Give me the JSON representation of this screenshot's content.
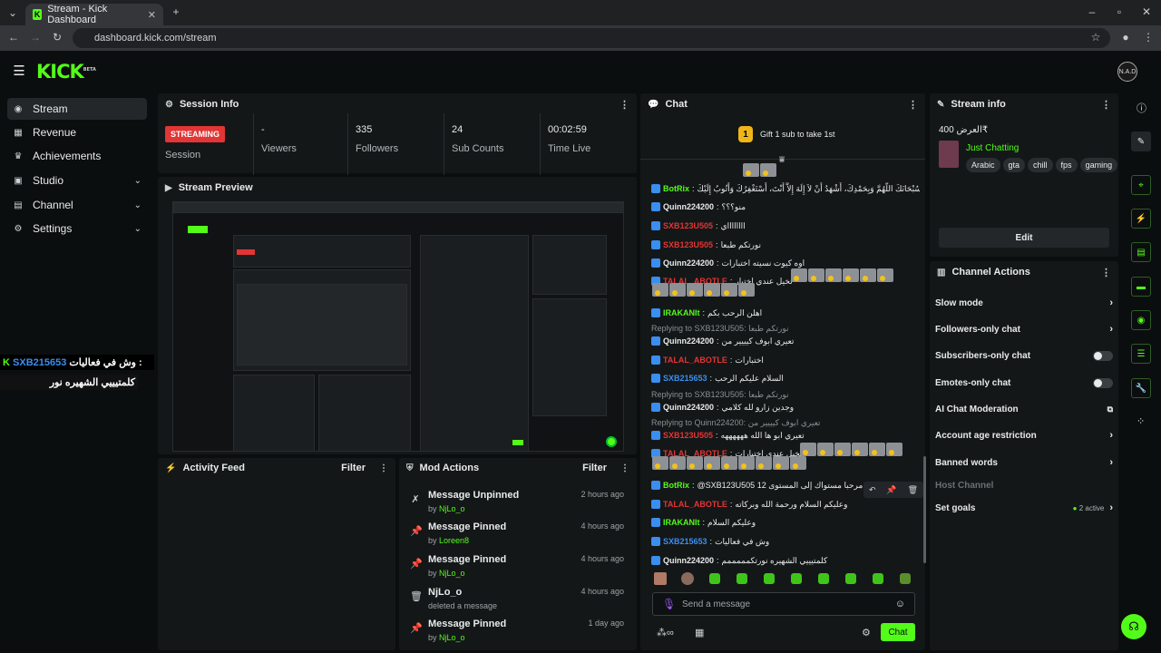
{
  "browser": {
    "tab_title": "Stream - Kick Dashboard",
    "url": "dashboard.kick.com/stream"
  },
  "header": {
    "logo": "KICK",
    "logo_badge": "BETA",
    "avatar_text": "N.A.D"
  },
  "sidebar": {
    "items": [
      {
        "label": "Stream",
        "icon": "broadcast-icon"
      },
      {
        "label": "Revenue",
        "icon": "revenue-icon"
      },
      {
        "label": "Achievements",
        "icon": "trophy-icon"
      },
      {
        "label": "Studio",
        "icon": "studio-icon"
      },
      {
        "label": "Channel",
        "icon": "channel-icon"
      },
      {
        "label": "Settings",
        "icon": "gear-icon"
      }
    ]
  },
  "session": {
    "title": "Session Info",
    "status": "STREAMING",
    "status_label": "Session",
    "stats": [
      {
        "value": "-",
        "label": "Viewers"
      },
      {
        "value": "335",
        "label": "Followers"
      },
      {
        "value": "24",
        "label": "Sub Counts"
      },
      {
        "value": "00:02:59",
        "label": "Time Live"
      }
    ]
  },
  "preview": {
    "title": "Stream Preview"
  },
  "overlay_chat": [
    {
      "user": "SXB215653",
      "text": "وش في فعاليات :"
    },
    {
      "user": "",
      "text": "كلمتيييي الشهيره نور"
    }
  ],
  "activity_feed": {
    "title": "Activity Feed",
    "filter": "Filter"
  },
  "mod_actions": {
    "title": "Mod Actions",
    "filter": "Filter",
    "items": [
      {
        "title": "Message Unpinned",
        "prefix": "by",
        "user": "NjLo_o",
        "time": "2 hours ago",
        "icon": "unpin-icon"
      },
      {
        "title": "Message Pinned",
        "prefix": "by",
        "user": "Loreen8",
        "time": "4 hours ago",
        "icon": "pin-icon"
      },
      {
        "title": "Message Pinned",
        "prefix": "by",
        "user": "NjLo_o",
        "time": "4 hours ago",
        "icon": "pin-icon"
      },
      {
        "title": "NjLo_o",
        "prefix": "",
        "user": "deleted a message",
        "time": "4 hours ago",
        "icon": "trash-icon"
      },
      {
        "title": "Message Pinned",
        "prefix": "by",
        "user": "NjLo_o",
        "time": "1 day ago",
        "icon": "pin-icon"
      }
    ]
  },
  "chat": {
    "title": "Chat",
    "gift_count": "1",
    "gift_text": "Gift 1 sub to take 1st",
    "lines": [
      {
        "kind": "msg",
        "user": "BotRix",
        "color": "ug",
        "text": "سُبْحَانَكَ اللَّهُمَّ وَبِحَمْدِكَ، أَشْهَدُ أَنْ لاَ إِلَهَ إِلاَّ أَنْتَ، أَسْتَغْفِرُكَ وَأَتُوبُ إِلَيْكَ"
      },
      {
        "kind": "msg",
        "user": "Quinn224200",
        "color": "uq",
        "text": "منو؟؟؟"
      },
      {
        "kind": "msg",
        "user": "SXB123U505",
        "color": "ur",
        "text": "ااااااااي"
      },
      {
        "kind": "msg",
        "user": "SXB123U505",
        "color": "ur",
        "text": "نورتكم طبعا"
      },
      {
        "kind": "msg",
        "user": "Quinn224200",
        "color": "uq",
        "text": "اوه كيوت نسيته اختبارات"
      },
      {
        "kind": "msg",
        "user": "TALAL_ABOTLE",
        "color": "ur",
        "text": "تخيل عندي اختبار"
      },
      {
        "kind": "msg",
        "user": "IRAKANIt",
        "color": "ug",
        "text": "اهلن الرحب بكم"
      },
      {
        "kind": "reply",
        "text": "Replying to SXB123U505: نورتكم طبعا"
      },
      {
        "kind": "msg",
        "user": "Quinn224200",
        "color": "uq",
        "text": "تعيري ابوف كيييير من"
      },
      {
        "kind": "msg",
        "user": "TALAL_ABOTLE",
        "color": "ur",
        "text": "اختبارات"
      },
      {
        "kind": "msg",
        "user": "SXB215653",
        "color": "ub",
        "text": "السلام عليكم الرحب"
      },
      {
        "kind": "reply",
        "text": "Replying to SXB123U505: نورتكم طبعا"
      },
      {
        "kind": "msg",
        "user": "Quinn224200",
        "color": "uq",
        "text": "وجدين زارو لله كلامي"
      },
      {
        "kind": "reply",
        "text": "Replying to Quinn224200: تعيري ابوف كيييير من"
      },
      {
        "kind": "msg",
        "user": "SXB123U505",
        "color": "ur",
        "text": "تعيري ابو ها الله ههههههه"
      },
      {
        "kind": "msg",
        "user": "TALAL_ABOTLE",
        "color": "ur",
        "text": "تخيل عندي اختبارات"
      },
      {
        "kind": "msg",
        "user": "BotRix",
        "color": "ug",
        "text": "@SXB123U505 12 نمت مرحبا مستواك إلى المستوى"
      },
      {
        "kind": "msg",
        "user": "TALAL_ABOTLE",
        "color": "ur",
        "text": "وعليكم السلام ورحمة الله وبركاته"
      },
      {
        "kind": "msg",
        "user": "IRAKANIt",
        "color": "ug",
        "text": "وعليكم السلام"
      },
      {
        "kind": "msg",
        "user": "SXB215653",
        "color": "ub",
        "text": "وش في فعاليات"
      },
      {
        "kind": "msg",
        "user": "Quinn224200",
        "color": "uq",
        "text": "كلمتيييي الشهيره نورتكمممممم"
      }
    ],
    "input_placeholder": "Send a message",
    "send_label": "Chat"
  },
  "stream_info": {
    "title": "Stream info",
    "stream_title": "العرض 400₹",
    "category": "Just Chatting",
    "tags": [
      "Arabic",
      "gta",
      "chill",
      "fps",
      "gaming"
    ],
    "edit_label": "Edit"
  },
  "channel_actions": {
    "title": "Channel Actions",
    "items": [
      {
        "label": "Slow mode",
        "control": "chevron"
      },
      {
        "label": "Followers-only chat",
        "control": "chevron"
      },
      {
        "label": "Subscribers-only chat",
        "control": "toggle"
      },
      {
        "label": "Emotes-only chat",
        "control": "toggle"
      },
      {
        "label": "AI Chat Moderation",
        "control": "external"
      },
      {
        "label": "Account age restriction",
        "control": "chevron"
      },
      {
        "label": "Banned words",
        "control": "chevron"
      },
      {
        "label": "Host Channel",
        "control": "none"
      },
      {
        "label": "Set goals",
        "control": "chevron",
        "extra": "2 active"
      }
    ]
  },
  "colors": {
    "accent": "#53fc18",
    "live": "#e23535",
    "panel": "#141718"
  }
}
